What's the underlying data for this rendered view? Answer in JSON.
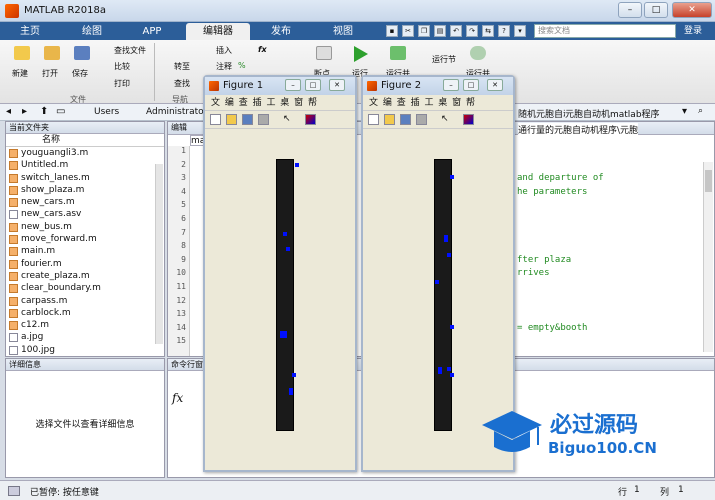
{
  "window": {
    "title": "MATLAB R2018a",
    "controls": [
      "–",
      "□",
      "✕"
    ]
  },
  "tabs": [
    "主页",
    "绘图",
    "APP",
    "编辑器",
    "发布",
    "视图"
  ],
  "search": {
    "placeholder": "搜索文档"
  },
  "login": "登录",
  "ribbon": {
    "file_group": "文件",
    "new": "新建",
    "open": "打开",
    "save": "保存",
    "find_files": "查找文件",
    "compare": "比较",
    "print": "打印",
    "nav_group": "导航",
    "goto": "转至",
    "find": "查找",
    "insert": "插入",
    "fx": "fx",
    "comment": "注释",
    "indent": "%",
    "breakpoint": "断点",
    "run": "运行",
    "run_advance": "运行并",
    "run_section": "运行节",
    "advance": "前进",
    "run_time": "运行并"
  },
  "path": {
    "items": [
      "Users",
      "Administrator"
    ],
    "right_items": [
      "随机元胞自动机程序",
      "元胞自动机matlab程序"
    ],
    "tail": "▾"
  },
  "current_folder": {
    "title": "当前文件夹",
    "col_name": "名称",
    "files": [
      {
        "name": "youguangli3.m",
        "type": "m"
      },
      {
        "name": "Untitled.m",
        "type": "m"
      },
      {
        "name": "switch_lanes.m",
        "type": "m"
      },
      {
        "name": "show_plaza.m",
        "type": "m"
      },
      {
        "name": "new_cars.m",
        "type": "m"
      },
      {
        "name": "new_cars.asv",
        "type": "asv"
      },
      {
        "name": "new_bus.m",
        "type": "m"
      },
      {
        "name": "move_forward.m",
        "type": "m"
      },
      {
        "name": "main.m",
        "type": "m"
      },
      {
        "name": "fourier.m",
        "type": "m"
      },
      {
        "name": "create_plaza.m",
        "type": "m"
      },
      {
        "name": "clear_boundary.m",
        "type": "m"
      },
      {
        "name": "carpass.m",
        "type": "m"
      },
      {
        "name": "carblock.m",
        "type": "m"
      },
      {
        "name": "c12.m",
        "type": "m"
      },
      {
        "name": "a.jpg",
        "type": "jpg"
      },
      {
        "name": "100.jpg",
        "type": "jpg"
      }
    ]
  },
  "details": {
    "title": "详细信息",
    "message": "选择文件以查看详细信息"
  },
  "editor": {
    "tab_label": "编辑",
    "file_tab": "ma",
    "path_text": "通行量的元胞自动机程序\\元胞",
    "line_numbers": [
      "1",
      "2",
      "3",
      "4",
      "5",
      "6",
      "7",
      "8",
      "9",
      "10",
      "11",
      "12",
      "13",
      "14",
      "15"
    ],
    "code_lines": [
      {
        "text": "and departure of",
        "line": 3
      },
      {
        "text": "he parameters",
        "line": 4
      },
      {
        "text": "fter plaza",
        "line": 9
      },
      {
        "text": "rrives",
        "line": 10
      },
      {
        "text": "= empty&booth",
        "line": 14
      }
    ]
  },
  "command": {
    "title": "命令行窗口",
    "prompt": "fx"
  },
  "status": {
    "text": "已暂停: 按任意键",
    "row_label": "行",
    "row": "1",
    "col_label": "列",
    "col": "1"
  },
  "figures": [
    {
      "title": "Figure 1",
      "menu": "文 编 查 插 工 桌 窗 帮",
      "cells": [
        [
          6,
          1
        ],
        [
          2,
          24
        ],
        [
          3,
          29
        ],
        [
          1,
          57
        ],
        [
          2,
          57
        ],
        [
          1,
          58
        ],
        [
          2,
          58
        ],
        [
          5,
          71
        ],
        [
          4,
          76
        ],
        [
          4,
          77
        ]
      ]
    },
    {
      "title": "Figure 2",
      "menu": "文 编 查 插 工 桌 窗 帮",
      "cells": [
        [
          5,
          5
        ],
        [
          3,
          25
        ],
        [
          3,
          26
        ],
        [
          4,
          31
        ],
        [
          0,
          40
        ],
        [
          5,
          55
        ],
        [
          4,
          69
        ],
        [
          1,
          69
        ],
        [
          1,
          70
        ],
        [
          5,
          71
        ]
      ]
    }
  ],
  "watermark": {
    "title": "必过源码",
    "url": "Biguo100.CN"
  },
  "colors": {
    "accent": "#2c5e99",
    "marker": "#0010ff",
    "watermark": "#1a6fd0"
  }
}
